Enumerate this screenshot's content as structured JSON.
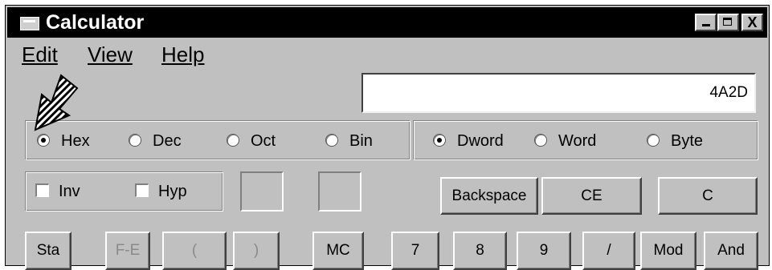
{
  "window": {
    "title": "Calculator",
    "controls": {
      "minimize": "",
      "maximize": "",
      "close": "X"
    }
  },
  "menu": [
    "Edit",
    "View",
    "Help"
  ],
  "display": {
    "value": "4A2D"
  },
  "number_base": {
    "options": [
      "Hex",
      "Dec",
      "Oct",
      "Bin"
    ],
    "selected": "Hex"
  },
  "word_size": {
    "options": [
      "Dword",
      "Word",
      "Byte"
    ],
    "selected": "Dword"
  },
  "flags": [
    "Inv",
    "Hyp"
  ],
  "edit_buttons": [
    "Backspace",
    "CE",
    "C"
  ],
  "keypad_row": [
    "Sta",
    "F-E",
    "(",
    ")",
    "MC",
    "7",
    "8",
    "9",
    "/",
    "Mod",
    "And"
  ],
  "icons": {
    "app": "calculator-icon",
    "pointer": "hatched-arrow-cursor"
  }
}
